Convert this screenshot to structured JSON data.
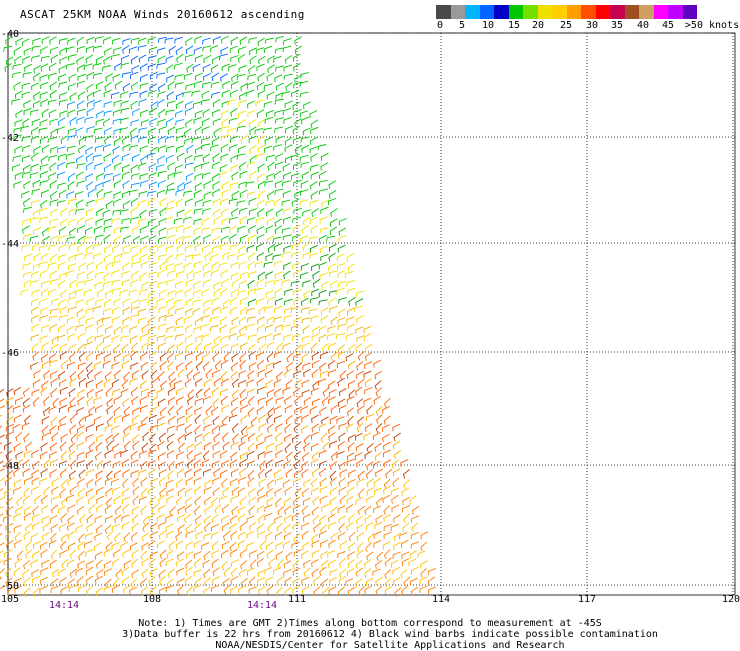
{
  "title": "ASCAT 25KM NOAA Winds 20160612 ascending",
  "colorbar": {
    "colors": [
      "#4a4a4a",
      "#9a9a9a",
      "#00b4ff",
      "#0064ff",
      "#0000c8",
      "#00c800",
      "#78e000",
      "#f0e000",
      "#ffd000",
      "#ff9c00",
      "#ff5000",
      "#ff0000",
      "#c80050",
      "#a05020",
      "#d0a060",
      "#ff00ff",
      "#c000ff",
      "#6000c0"
    ],
    "labels": [
      "0",
      "5",
      "10",
      "15",
      "20",
      "25",
      "30",
      "35",
      "40",
      "45",
      ">50 knots"
    ]
  },
  "lat_labels": [
    "-40",
    "-42",
    "-44",
    "-46",
    "-48",
    "-50"
  ],
  "lon_labels": [
    "105",
    "108",
    "111",
    "114",
    "117",
    "120"
  ],
  "times": [
    "14:14",
    "14:14"
  ],
  "notes": {
    "line1": "Note: 1) Times are GMT 2)Times along bottom correspond to measurement at -45S",
    "line2": "3)Data buffer is 22 hrs from 20160612 4) Black wind barbs indicate possible contamination",
    "line3": "NOAA/NESDIS/Center for Satellite Applications and Research"
  }
}
